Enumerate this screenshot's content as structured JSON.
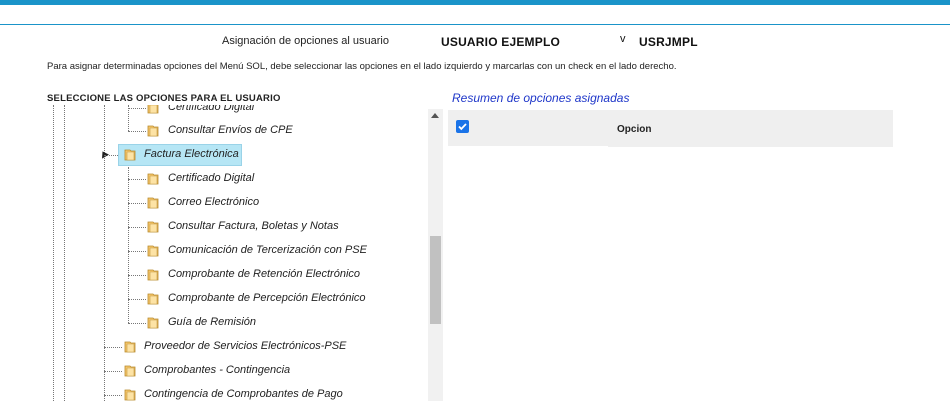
{
  "header": {
    "assign_label": "Asignación de opciones al usuario",
    "user_name": "USUARIO EJEMPLO",
    "user_dropdown_glyph": "v",
    "user_code": "USRJMPL"
  },
  "instructions": "Para asignar determinadas opciones del Menú SOL, debe seleccionar las opciones en el lado izquierdo y marcarlas con un check en el lado derecho.",
  "tree_panel": {
    "title": "SELECCIONE LAS OPCIONES PARA EL USUARIO",
    "items": [
      "Certificado Digital",
      "Consultar Envíos de CPE",
      "Factura Electrónica",
      "Certificado Digital",
      "Correo Electrónico",
      "Consultar Factura, Boletas y Notas",
      "Comunicación de Tercerización con PSE",
      "Comprobante de Retención Electrónico",
      "Comprobante de Percepción Electrónico",
      "Guía de Remisión",
      "Proveedor de Servicios Electrónicos-PSE",
      "Comprobantes - Contingencia",
      "Contingencia de Comprobantes de Pago"
    ]
  },
  "summary_panel": {
    "title": "Resumen de opciones asignadas",
    "column_header": "Opcion",
    "select_all_checked": true
  },
  "colors": {
    "accent": "#1a94c9",
    "selected_node": "#b6e6f5",
    "summary_title": "#1e36c9"
  }
}
